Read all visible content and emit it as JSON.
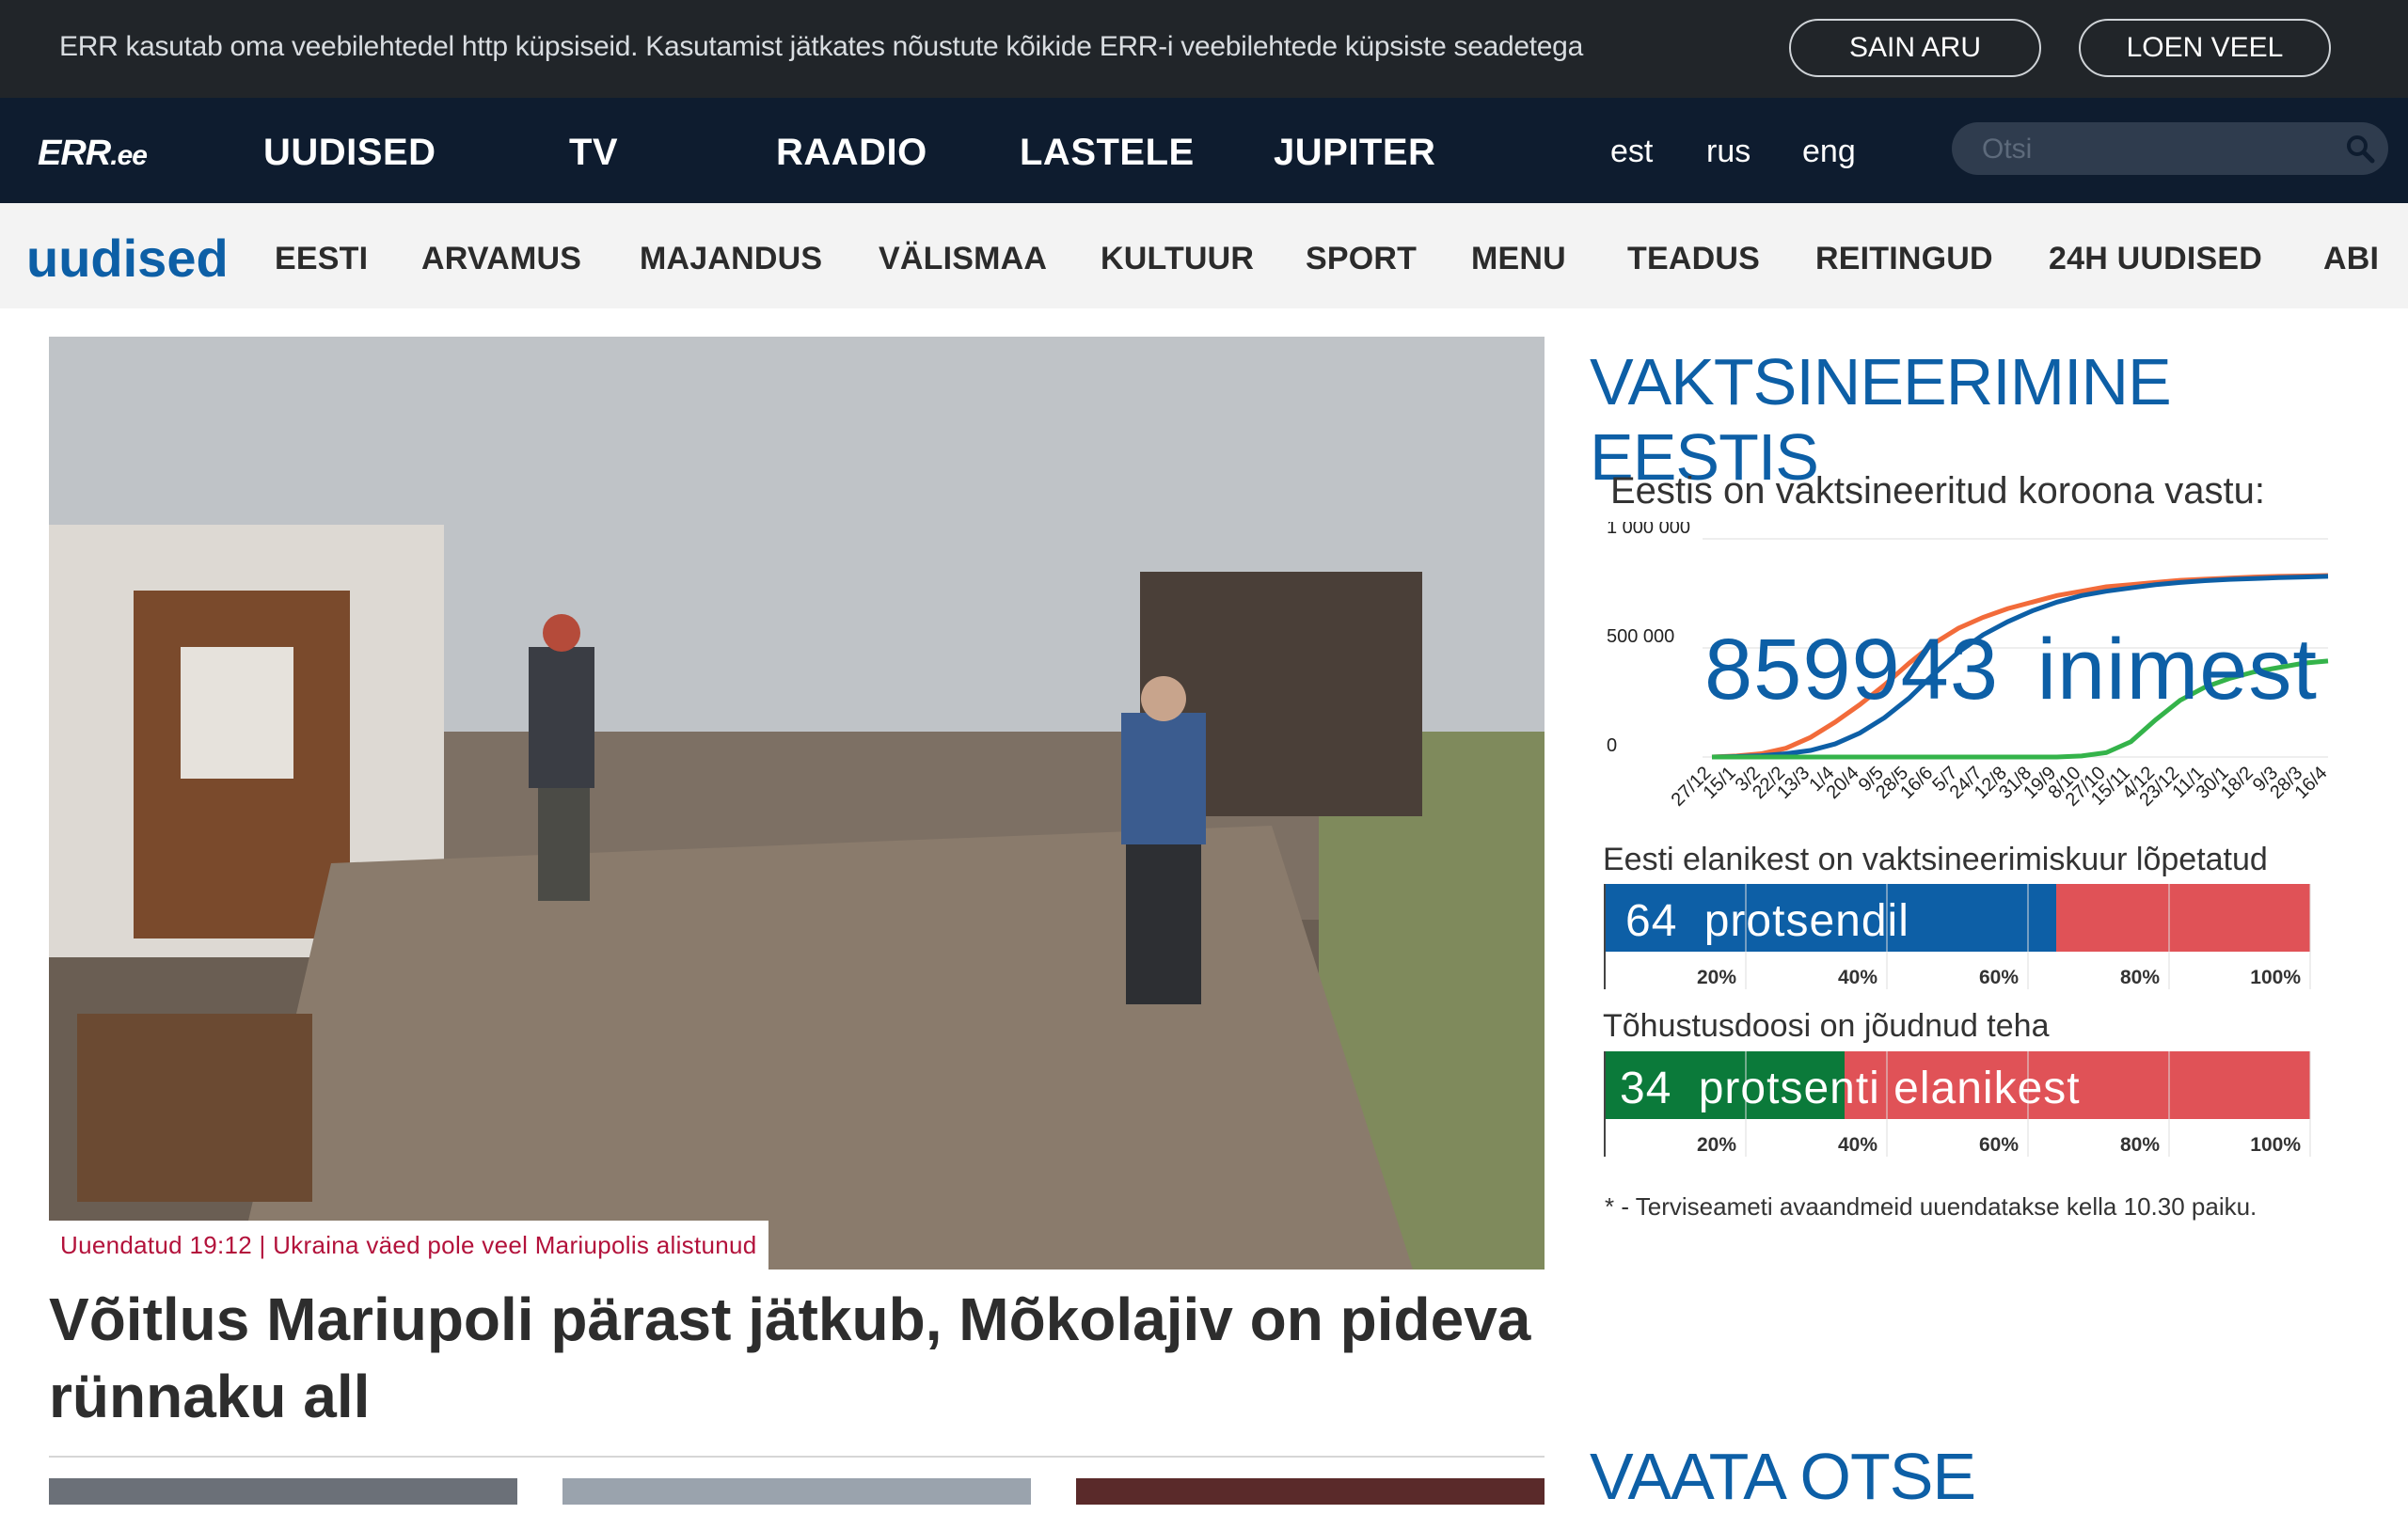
{
  "cookie": {
    "message": "ERR kasutab oma veebilehtedel http küpsiseid. Kasutamist jätkates nõustute kõikide ERR-i veebilehtede küpsiste seadetega",
    "accept_label": "SAIN ARU",
    "more_label": "LOEN VEEL"
  },
  "header": {
    "logo_main": "ERR",
    "logo_suffix": ".ee",
    "nav": [
      "UUDISED",
      "TV",
      "RAADIO",
      "LASTELE",
      "JUPITER"
    ],
    "languages": [
      "est",
      "rus",
      "eng"
    ],
    "search_placeholder": "Otsi",
    "search_icon": "search-icon"
  },
  "section_nav": {
    "brand": "uudised",
    "items": [
      "EESTI",
      "ARVAMUS",
      "MAJANDUS",
      "VÄLISMAA",
      "KULTUUR",
      "SPORT",
      "MENU",
      "TEADUS",
      "REITINGUD",
      "24H UUDISED",
      "ABI"
    ]
  },
  "hero": {
    "tag": "Uuendatud 19:12 | Ukraina väed pole veel Mariupolis alistunud",
    "title": "Võitlus Mariupoli pärast jätkub, Mõkolajiv on pideva rünnaku all"
  },
  "vaccination": {
    "heading": "VAKTSINEERIMINE EESTIS",
    "subtitle": "Eestis on vaktsineeritud koroona vastu:",
    "count": "859943",
    "count_unit": "inimest",
    "completed_label": "Eesti elanikest on vaktsineerimiskuur lõpetatud",
    "completed_value": "64",
    "completed_unit": "protsendil",
    "booster_label": "Tõhustusdoosi on jõudnud teha",
    "booster_value": "34",
    "booster_unit": "protsenti elanikest",
    "footnote": "* - Terviseameti avaandmeid uuendatakse kella 10.30 paiku.",
    "colors": {
      "blue": "#0d5fa6",
      "orange": "#f26b3a",
      "green": "#34b34a",
      "red": "#e05257",
      "darkgreen": "#0b7a3a"
    }
  },
  "chart_data": {
    "type": "line",
    "title": "Eestis on vaktsineeritud koroona vastu:",
    "y_ticks": [
      "1 000 000",
      "500 000",
      "0"
    ],
    "ylim": [
      0,
      1000000
    ],
    "x": [
      "27/12",
      "15/1",
      "3/2",
      "22/2",
      "13/3",
      "1/4",
      "20/4",
      "9/5",
      "28/5",
      "16/6",
      "5/7",
      "24/7",
      "12/8",
      "31/8",
      "19/9",
      "8/10",
      "27/10",
      "15/11",
      "4/12",
      "23/12",
      "11/1",
      "30/1",
      "18/2",
      "9/3",
      "28/3",
      "16/4"
    ],
    "series": [
      {
        "color": "#f26b3a",
        "values": [
          0,
          5000,
          15000,
          40000,
          90000,
          160000,
          240000,
          330000,
          430000,
          520000,
          590000,
          640000,
          680000,
          710000,
          740000,
          760000,
          780000,
          790000,
          800000,
          810000,
          815000,
          820000,
          825000,
          828000,
          830000,
          832000
        ]
      },
      {
        "color": "#0d5fa6",
        "values": [
          0,
          2000,
          6000,
          15000,
          30000,
          60000,
          110000,
          180000,
          270000,
          380000,
          480000,
          560000,
          620000,
          670000,
          710000,
          740000,
          760000,
          775000,
          790000,
          800000,
          808000,
          814000,
          818000,
          822000,
          825000,
          828000
        ]
      },
      {
        "color": "#34b34a",
        "values": [
          0,
          0,
          0,
          0,
          0,
          0,
          0,
          0,
          0,
          0,
          0,
          0,
          0,
          0,
          0,
          5000,
          20000,
          70000,
          170000,
          260000,
          320000,
          360000,
          390000,
          410000,
          430000,
          440000
        ]
      }
    ]
  },
  "bars": {
    "ticks": [
      "20%",
      "40%",
      "60%",
      "80%",
      "100%"
    ],
    "completed_pct": 64,
    "booster_pct": 34
  },
  "live": {
    "heading": "VAATA OTSE"
  }
}
